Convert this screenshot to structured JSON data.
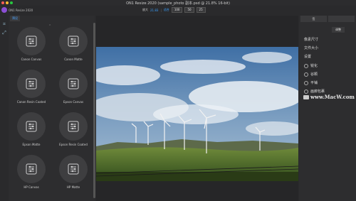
{
  "window": {
    "title": "ON1 Resize 2020 (sample_photo 副本.psd @ 21.8% 16-bit)",
    "app_name": "ON1 Resize 2020"
  },
  "toolbar": {
    "zoom_label": "放大",
    "zoom_value": "21.83",
    "fit_label": "适合",
    "btn_100": "100",
    "btn_50": "50",
    "btn_25": "25"
  },
  "presets_panel": {
    "tab_label": "预设",
    "items": [
      {
        "label": "Canon Canvas"
      },
      {
        "label": "Canon Matte"
      },
      {
        "label": "Canon Resin Coated"
      },
      {
        "label": "Epson Canvas"
      },
      {
        "label": "Epson Matte"
      },
      {
        "label": "Epson Resin Coated"
      },
      {
        "label": "HP Canvas"
      },
      {
        "label": "HP Matte"
      }
    ]
  },
  "right_panel": {
    "tab1": "签",
    "tab2": "",
    "adjust_button": "调整",
    "items": [
      {
        "label": "像素尺寸",
        "radio": false
      },
      {
        "label": "文件大小",
        "radio": false
      },
      {
        "label": "设置",
        "radio": false
      },
      {
        "label": "锐化",
        "radio": true
      },
      {
        "label": "谷颗",
        "radio": true
      },
      {
        "label": "平铺",
        "radio": true
      },
      {
        "label": "画廊包裹",
        "radio": true
      }
    ]
  },
  "watermark": "www.MacW.com",
  "colors": {
    "accent": "#3aa0ff",
    "app_logo": "#8b4fd4"
  }
}
